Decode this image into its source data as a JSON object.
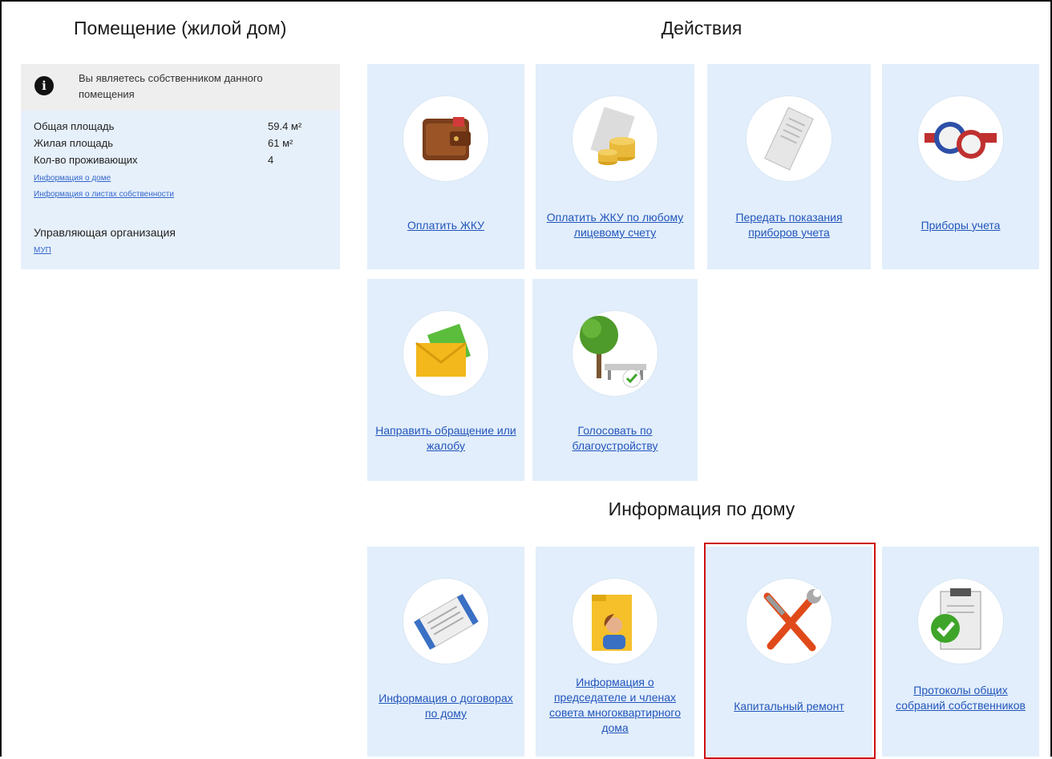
{
  "left_section": {
    "title": "Помещение (жилой дом)",
    "notice": "Вы являетесь собственником данного помещения",
    "details": [
      {
        "label": "Общая площадь",
        "value": "59.4 м²"
      },
      {
        "label": "Жилая площадь",
        "value": "61 м²"
      },
      {
        "label": "Кол-во проживающих",
        "value": "4"
      }
    ],
    "links": [
      "Информация о доме",
      "Информация о листах собственности"
    ],
    "org_label": "Управляющая организация",
    "org_link": "МУП"
  },
  "actions": {
    "title": "Действия",
    "tiles": [
      {
        "label": "Оплатить ЖКУ",
        "icon": "wallet-icon"
      },
      {
        "label": "Оплатить ЖКУ по любому лицевому счету",
        "icon": "coins-icon"
      },
      {
        "label": "Передать показания приборов учета",
        "icon": "receipt-icon"
      },
      {
        "label": "Приборы учета",
        "icon": "meter-icon"
      },
      {
        "label": "Направить обращение или жалобу",
        "icon": "envelope-icon"
      },
      {
        "label": "Голосовать по благоустройству",
        "icon": "park-icon"
      }
    ]
  },
  "house_info": {
    "title": "Информация по дому",
    "tiles": [
      {
        "label": "Информация о договорах по дому",
        "icon": "document-icon"
      },
      {
        "label": "Информация о председателе и членах совета многоквартирного дома",
        "icon": "folder-person-icon"
      },
      {
        "label": "Капитальный ремонт",
        "icon": "tools-icon"
      },
      {
        "label": "Протоколы общих собраний собственников",
        "icon": "clipboard-check-icon"
      }
    ]
  }
}
